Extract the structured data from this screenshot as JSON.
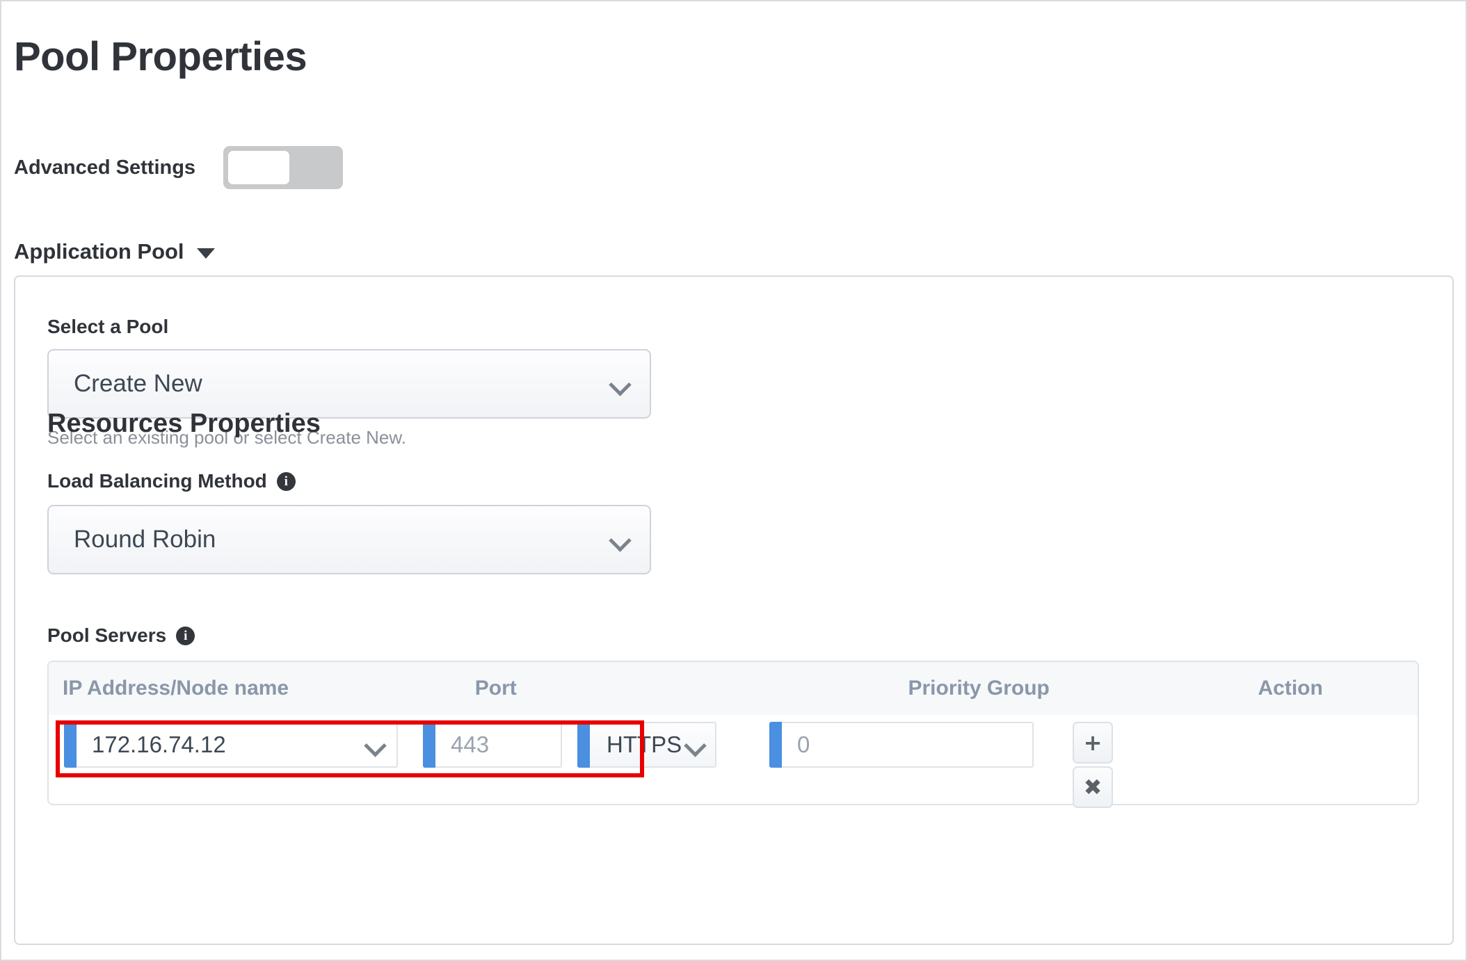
{
  "page": {
    "title": "Pool Properties"
  },
  "advanced_settings": {
    "label": "Advanced Settings",
    "state": "off"
  },
  "application_pool_section": {
    "label": "Application Pool",
    "caret_icon": "caret-down-icon",
    "expanded": true
  },
  "select_pool": {
    "label": "Select a Pool",
    "value": "Create New",
    "chevron_icon": "chevron-down-icon",
    "help_text": "Select an existing pool or select Create New."
  },
  "resources_properties": {
    "heading": "Resources Properties"
  },
  "load_balancing_method": {
    "label": "Load Balancing Method",
    "info_icon": "info-icon",
    "info_glyph": "i",
    "value": "Round Robin",
    "chevron_icon": "chevron-down-icon"
  },
  "pool_servers": {
    "label": "Pool Servers",
    "info_icon": "info-icon",
    "info_glyph": "i",
    "columns": [
      "IP Address/Node name",
      "Port",
      "Priority Group",
      "Action"
    ],
    "rows": [
      {
        "ip_address": "172.16.74.12",
        "ip_chevron_icon": "chevron-down-icon",
        "port": "443",
        "protocol": "HTTPS",
        "protocol_chevron_icon": "chevron-down-icon",
        "priority_group": "0",
        "add_button_label": "+",
        "remove_button_label": "✖"
      }
    ],
    "highlight_color": "#e80000",
    "field_accent_color": "#4a8fe0"
  }
}
